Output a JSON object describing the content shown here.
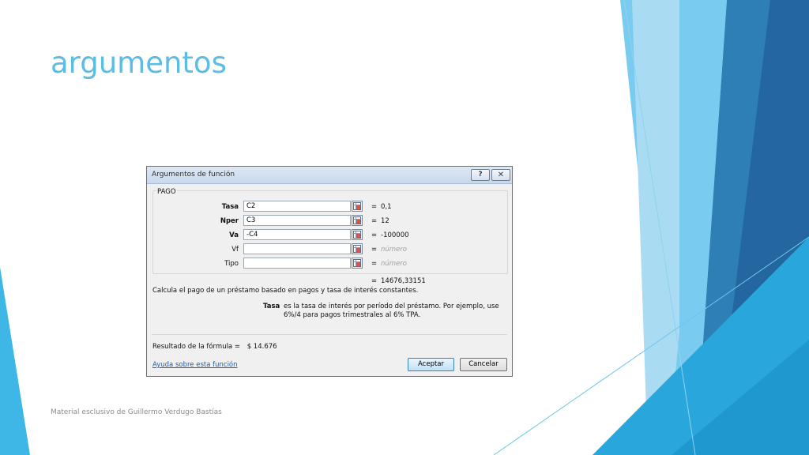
{
  "slide": {
    "title": "argumentos",
    "footer": "Material esclusivo de Guillermo Verdugo Bastías"
  },
  "dialog": {
    "title": "Argumentos de función",
    "help_button": "?",
    "close_button": "✕",
    "function_name": "PAGO",
    "args": [
      {
        "label": "Tasa",
        "value": "C2",
        "result": "0,1",
        "required": true
      },
      {
        "label": "Nper",
        "value": "C3",
        "result": "12",
        "required": true
      },
      {
        "label": "Va",
        "value": "-C4",
        "result": "-100000",
        "required": true
      },
      {
        "label": "Vf",
        "value": "",
        "result": "número",
        "required": false
      },
      {
        "label": "Tipo",
        "value": "",
        "result": "número",
        "required": false
      }
    ],
    "equals": "=",
    "result_value": "14676,33151",
    "description": "Calcula el pago de un préstamo basado en pagos y tasa de interés constantes.",
    "param_name": "Tasa",
    "param_description": "es la tasa de interés por período del préstamo. Por ejemplo, use 6%/4 para pagos trimestrales al 6% TPA.",
    "formula_result_label": "Resultado de la fórmula =",
    "formula_result_value": "$ 14.676",
    "help_link": "Ayuda sobre esta función",
    "ok_button": "Aceptar",
    "cancel_button": "Cancelar"
  },
  "colors": {
    "title": "#5bbde6",
    "accent_light": "#a6dcf3",
    "accent_mid": "#3fb1e3",
    "accent_dark": "#2a6fa3"
  }
}
